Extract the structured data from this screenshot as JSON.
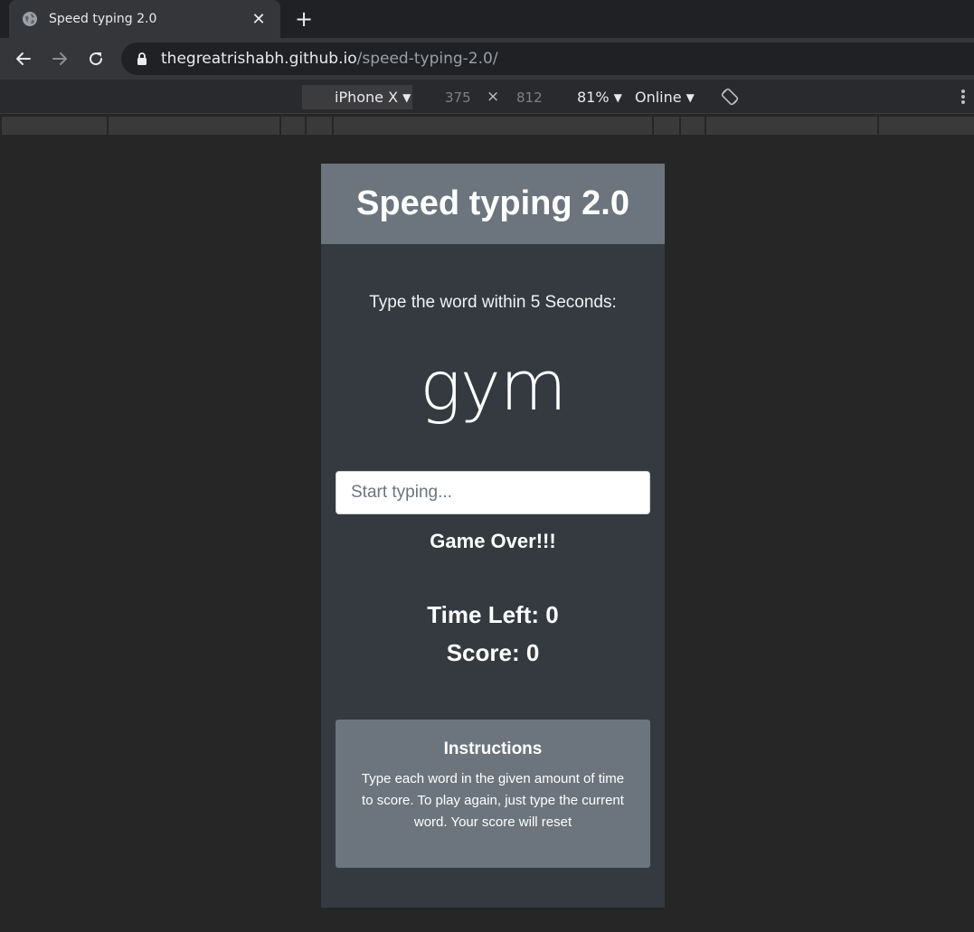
{
  "browser": {
    "tab_title": "Speed typing 2.0",
    "tab_close_glyph": "✕",
    "new_tab_glyph": "+",
    "url_host": "thegreatrishabh.github.io",
    "url_path": "/speed-typing-2.0/"
  },
  "device_toolbar": {
    "device": "iPhone X",
    "width": "375",
    "times": "×",
    "height": "812",
    "zoom": "81%",
    "network": "Online"
  },
  "app": {
    "title": "Speed typing 2.0",
    "prompt_prefix": "Type the word within ",
    "seconds": "5",
    "prompt_suffix": " Seconds:",
    "current_word": "gym",
    "input_placeholder": "Start typing...",
    "message": "Game Over!!!",
    "time_label": "Time Left: ",
    "time_value": "0",
    "score_label": "Score: ",
    "score_value": "0",
    "instructions_title": "Instructions",
    "instructions_text": "Type each word in the given amount of time to score. To play again, just type the current word. Your score will reset"
  },
  "colors": {
    "header_bg": "#6c757d",
    "page_bg": "#343a40",
    "devtools_bg": "#262626"
  }
}
